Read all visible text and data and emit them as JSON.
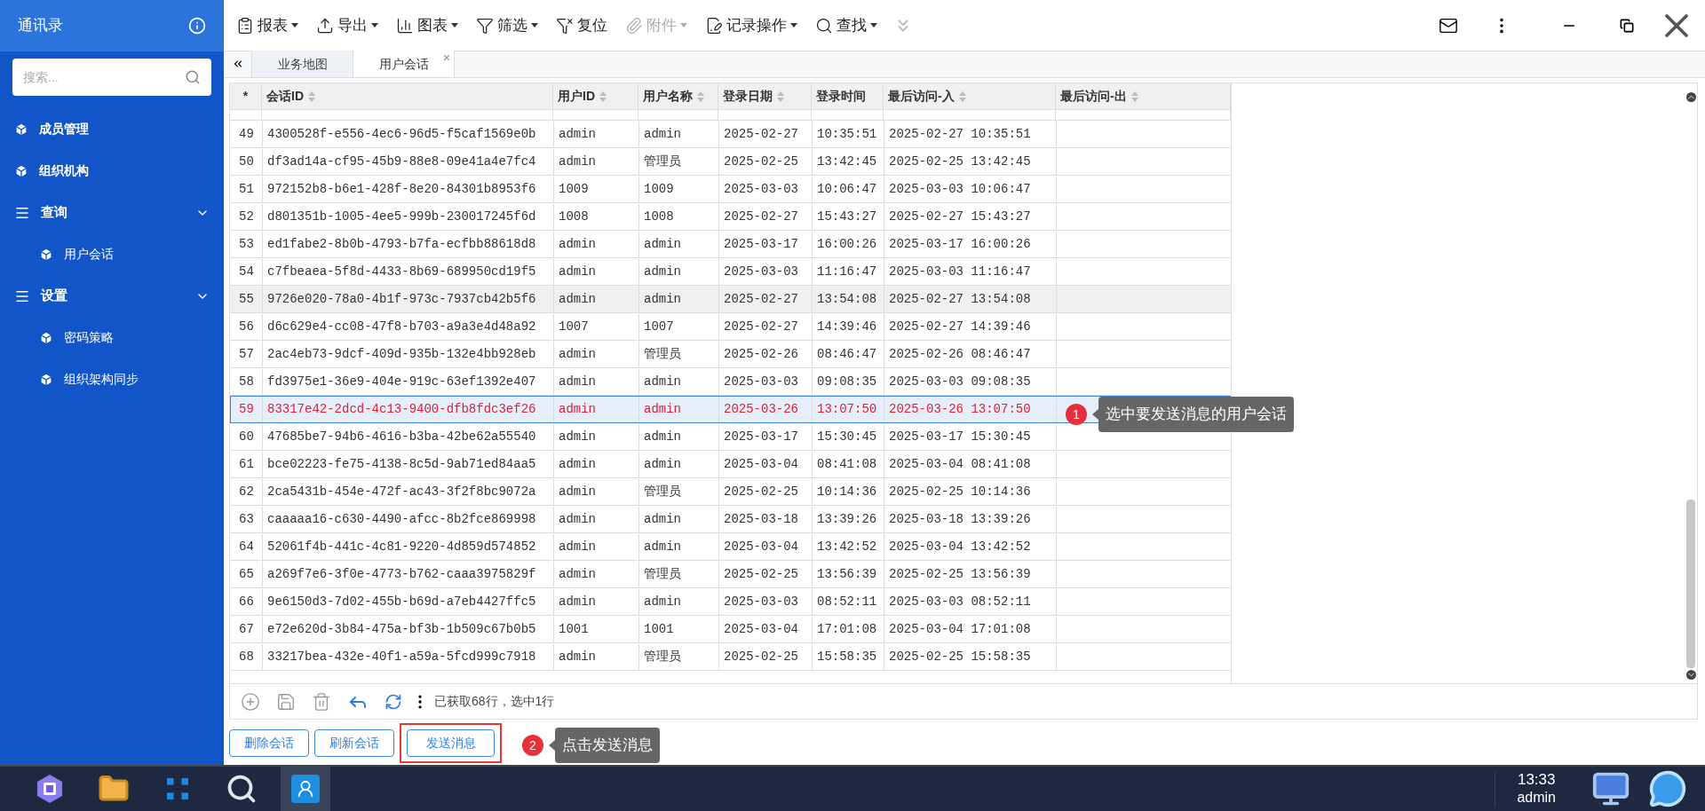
{
  "sidebar": {
    "title": "通讯录",
    "search": {
      "placeholder": "搜索..."
    },
    "items": [
      {
        "kind": "item",
        "label": "成员管理"
      },
      {
        "kind": "item",
        "label": "组织机构"
      },
      {
        "kind": "group",
        "label": "查询",
        "expanded": true,
        "children": [
          {
            "kind": "item",
            "label": "用户会话"
          }
        ]
      },
      {
        "kind": "group",
        "label": "设置",
        "expanded": true,
        "children": [
          {
            "kind": "item",
            "label": "密码策略"
          },
          {
            "kind": "item",
            "label": "组织架构同步"
          }
        ]
      }
    ]
  },
  "toolbar": [
    {
      "kind": "report",
      "label": "报表",
      "dropdown": true,
      "disabled": false
    },
    {
      "kind": "export",
      "label": "导出",
      "dropdown": true,
      "disabled": false
    },
    {
      "kind": "chart",
      "label": "图表",
      "dropdown": true,
      "disabled": false
    },
    {
      "kind": "filter",
      "label": "筛选",
      "dropdown": true,
      "disabled": false
    },
    {
      "kind": "reset",
      "label": "复位",
      "dropdown": false,
      "disabled": false
    },
    {
      "kind": "attach",
      "label": "附件",
      "dropdown": true,
      "disabled": true
    },
    {
      "kind": "record",
      "label": "记录操作",
      "dropdown": true,
      "disabled": false
    },
    {
      "kind": "find",
      "label": "查找",
      "dropdown": true,
      "disabled": false
    }
  ],
  "tabs": [
    {
      "label": "业务地图",
      "selected": false,
      "closable": false
    },
    {
      "label": "用户会话",
      "selected": true,
      "closable": true
    }
  ],
  "table": {
    "columns": [
      {
        "label": "*",
        "sortable": false
      },
      {
        "label": "会话ID",
        "sortable": true
      },
      {
        "label": "用户ID",
        "sortable": true
      },
      {
        "label": "用户名称",
        "sortable": true
      },
      {
        "label": "登录日期",
        "sortable": true
      },
      {
        "label": "登录时间",
        "sortable": false
      },
      {
        "label": "最后访问-入",
        "sortable": true
      },
      {
        "label": "最后访问-出",
        "sortable": true
      }
    ],
    "rows": [
      {
        "selected": false,
        "hovered": false,
        "cells": [
          "49",
          "4300528f-e556-4ec6-96d5-f5caf1569e0b",
          "admin",
          "admin",
          "2025-02-27",
          "10:35:51",
          "2025-02-27 10:35:51"
        ]
      },
      {
        "selected": false,
        "hovered": false,
        "cells": [
          "50",
          "df3ad14a-cf95-45b9-88e8-09e41a4e7fc4",
          "admin",
          "管理员",
          "2025-02-25",
          "13:42:45",
          "2025-02-25 13:42:45"
        ]
      },
      {
        "selected": false,
        "hovered": false,
        "cells": [
          "51",
          "972152b8-b6e1-428f-8e20-84301b8953f6",
          "1009",
          "1009",
          "2025-03-03",
          "10:06:47",
          "2025-03-03 10:06:47"
        ]
      },
      {
        "selected": false,
        "hovered": false,
        "cells": [
          "52",
          "d801351b-1005-4ee5-999b-230017245f6d",
          "1008",
          "1008",
          "2025-02-27",
          "15:43:27",
          "2025-02-27 15:43:27"
        ]
      },
      {
        "selected": false,
        "hovered": false,
        "cells": [
          "53",
          "ed1fabe2-8b0b-4793-b7fa-ecfbb88618d8",
          "admin",
          "admin",
          "2025-03-17",
          "16:00:26",
          "2025-03-17 16:00:26"
        ]
      },
      {
        "selected": false,
        "hovered": false,
        "cells": [
          "54",
          "c7fbeaea-5f8d-4433-8b69-689950cd19f5",
          "admin",
          "admin",
          "2025-03-03",
          "11:16:47",
          "2025-03-03 11:16:47"
        ]
      },
      {
        "selected": false,
        "hovered": true,
        "cells": [
          "55",
          "9726e020-78a0-4b1f-973c-7937cb42b5f6",
          "admin",
          "admin",
          "2025-02-27",
          "13:54:08",
          "2025-02-27 13:54:08"
        ]
      },
      {
        "selected": false,
        "hovered": false,
        "cells": [
          "56",
          "d6c629e4-cc08-47f8-b703-a9a3e4d48a92",
          "1007",
          "1007",
          "2025-02-27",
          "14:39:46",
          "2025-02-27 14:39:46"
        ]
      },
      {
        "selected": false,
        "hovered": false,
        "cells": [
          "57",
          "2ac4eb73-9dcf-409d-935b-132e4bb928eb",
          "admin",
          "管理员",
          "2025-02-26",
          "08:46:47",
          "2025-02-26 08:46:47"
        ]
      },
      {
        "selected": false,
        "hovered": false,
        "cells": [
          "58",
          "fd3975e1-36e9-404e-919c-63ef1392e407",
          "admin",
          "admin",
          "2025-03-03",
          "09:08:35",
          "2025-03-03 09:08:35"
        ]
      },
      {
        "selected": true,
        "hovered": false,
        "cells": [
          "59",
          "83317e42-2dcd-4c13-9400-dfb8fdc3ef26",
          "admin",
          "admin",
          "2025-03-26",
          "13:07:50",
          "2025-03-26 13:07:50"
        ]
      },
      {
        "selected": false,
        "hovered": false,
        "cells": [
          "60",
          "47685be7-94b6-4616-b3ba-42be62a55540",
          "admin",
          "admin",
          "2025-03-17",
          "15:30:45",
          "2025-03-17 15:30:45"
        ]
      },
      {
        "selected": false,
        "hovered": false,
        "cells": [
          "61",
          "bce02223-fe75-4138-8c5d-9ab71ed84aa5",
          "admin",
          "admin",
          "2025-03-04",
          "08:41:08",
          "2025-03-04 08:41:08"
        ]
      },
      {
        "selected": false,
        "hovered": false,
        "cells": [
          "62",
          "2ca5431b-454e-472f-ac43-3f2f8bc9072a",
          "admin",
          "管理员",
          "2025-02-25",
          "10:14:36",
          "2025-02-25 10:14:36"
        ]
      },
      {
        "selected": false,
        "hovered": false,
        "cells": [
          "63",
          "caaaaa16-c630-4490-afcc-8b2fce869998",
          "admin",
          "admin",
          "2025-03-18",
          "13:39:26",
          "2025-03-18 13:39:26"
        ]
      },
      {
        "selected": false,
        "hovered": false,
        "cells": [
          "64",
          "52061f4b-441c-4c81-9220-4d859d574852",
          "admin",
          "admin",
          "2025-03-04",
          "13:42:52",
          "2025-03-04 13:42:52"
        ]
      },
      {
        "selected": false,
        "hovered": false,
        "cells": [
          "65",
          "a269f7e6-3f0e-4773-b762-caaa3975829f",
          "admin",
          "管理员",
          "2025-02-25",
          "13:56:39",
          "2025-02-25 13:56:39"
        ]
      },
      {
        "selected": false,
        "hovered": false,
        "cells": [
          "66",
          "9e6150d3-7d02-455b-b69d-a7eb4427ffc5",
          "admin",
          "admin",
          "2025-03-03",
          "08:52:11",
          "2025-03-03 08:52:11"
        ]
      },
      {
        "selected": false,
        "hovered": false,
        "cells": [
          "67",
          "e72e620d-3b84-475a-bf3b-1b509c67b0b5",
          "1001",
          "1001",
          "2025-03-04",
          "17:01:08",
          "2025-03-04 17:01:08"
        ]
      },
      {
        "selected": false,
        "hovered": false,
        "cells": [
          "68",
          "33217bea-432e-40f1-a59a-5fcd999c7918",
          "admin",
          "管理员",
          "2025-02-25",
          "15:58:35",
          "2025-02-25 15:58:35"
        ]
      }
    ]
  },
  "status": "已获取68行，选中1行",
  "buttons": [
    {
      "label": "删除会话",
      "framed": false
    },
    {
      "label": "刷新会话",
      "framed": false
    },
    {
      "label": "发送消息",
      "framed": true
    }
  ],
  "callouts": [
    {
      "number": "1",
      "text": "选中要发送消息的用户会话"
    },
    {
      "number": "2",
      "text": "点击发送消息"
    }
  ],
  "taskbar": {
    "apps": [
      {
        "kind": "logo",
        "selected": false
      },
      {
        "kind": "folder",
        "selected": false
      },
      {
        "kind": "grid",
        "selected": false
      },
      {
        "kind": "search",
        "selected": false
      },
      {
        "kind": "contacts",
        "selected": true
      }
    ],
    "time": "13:33",
    "user": "admin"
  }
}
